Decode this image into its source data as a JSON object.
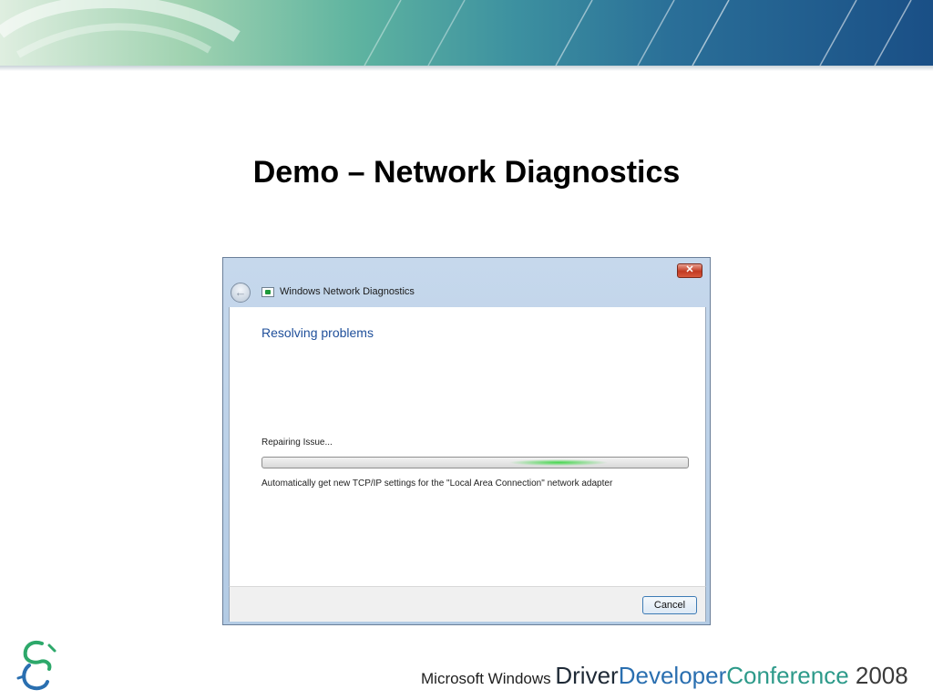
{
  "slide": {
    "title": "Demo – Network Diagnostics"
  },
  "dialog": {
    "window_title": "Windows Network Diagnostics",
    "close_glyph": "✕",
    "back_glyph": "←",
    "heading": "Resolving problems",
    "status_label": "Repairing Issue...",
    "progress_state": "indeterminate",
    "detail_text": "Automatically get new TCP/IP settings for the \"Local Area Connection\" network adapter",
    "cancel_label": "Cancel",
    "colors": {
      "heading": "#1f4f9a",
      "chrome": "#b3cbe4",
      "close": "#c23a22",
      "progress_glow": "#43d64b"
    }
  },
  "footer": {
    "brand_prefix": "Microsoft Windows ",
    "brand_driver": "Driver",
    "brand_developer": "Developer",
    "brand_conference": "Conference",
    "brand_year": " 2008",
    "logo_icon": "ddc-logo-icon"
  }
}
